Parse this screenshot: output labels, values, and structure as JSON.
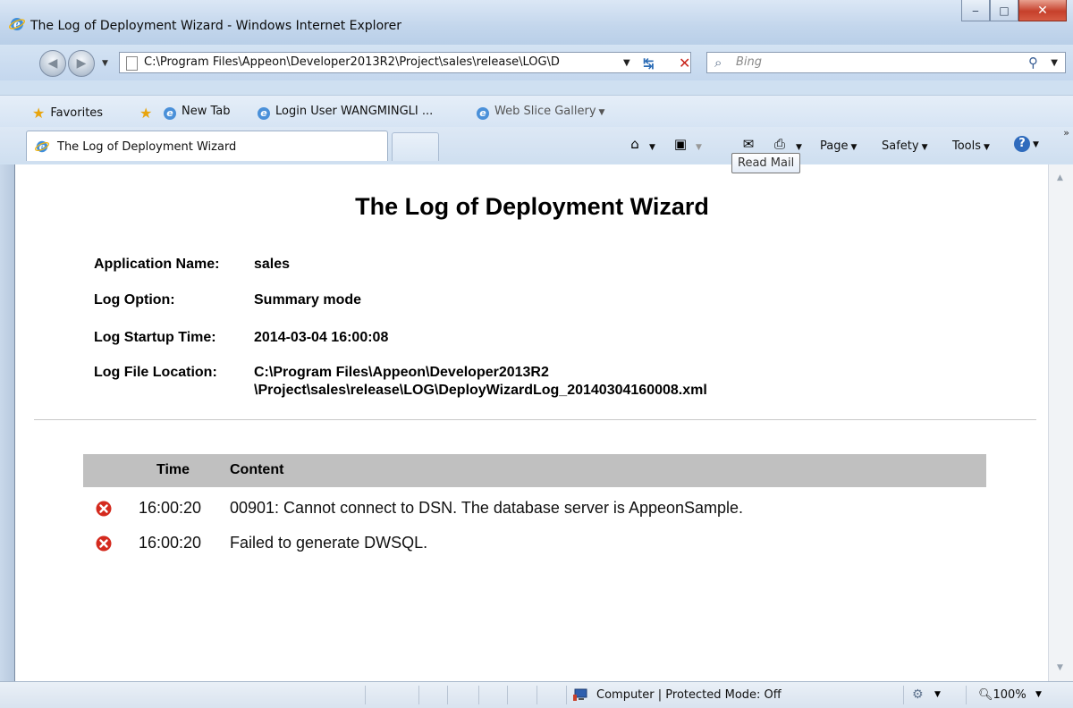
{
  "window": {
    "title": "The Log of Deployment Wizard - Windows Internet Explorer",
    "minimize_glyph": "‒",
    "maximize_glyph": "□",
    "close_glyph": "✕"
  },
  "nav": {
    "address": "C:\\Program Files\\Appeon\\Developer2013R2\\Project\\sales\\release\\LOG\\D",
    "search_placeholder": "Bing"
  },
  "favorites": {
    "label": "Favorites",
    "items": [
      "New Tab",
      "Login User WANGMINGLI ...",
      "Web Slice Gallery"
    ]
  },
  "tab": {
    "title": "The Log of Deployment Wizard"
  },
  "commands": {
    "page": "Page",
    "safety": "Safety",
    "tools": "Tools",
    "tooltip": "Read Mail"
  },
  "document": {
    "title": "The Log of Deployment Wizard",
    "meta": [
      {
        "label": "Application Name:",
        "value": "sales"
      },
      {
        "label": "Log Option:",
        "value": "Summary mode"
      },
      {
        "label": "Log Startup Time:",
        "value": "2014-03-04 16:00:08"
      },
      {
        "label": "Log File Location:",
        "value": "C:\\Program Files\\Appeon\\Developer2013R2",
        "value2": "\\Project\\sales\\release\\LOG\\DeployWizardLog_20140304160008.xml"
      }
    ],
    "table": {
      "headers": [
        "Time",
        "Content"
      ],
      "rows": [
        {
          "time": "16:00:20",
          "content": "00901: Cannot connect to DSN. The database server is AppeonSample."
        },
        {
          "time": "16:00:20",
          "content": "Failed to generate DWSQL."
        }
      ]
    }
  },
  "status": {
    "zone": "Computer | Protected Mode: Off",
    "zoom": "100%"
  },
  "colors": {
    "table_header": "#c0c0c0",
    "error_icon": "#d42a1e",
    "chrome": "#cfe0f1"
  }
}
